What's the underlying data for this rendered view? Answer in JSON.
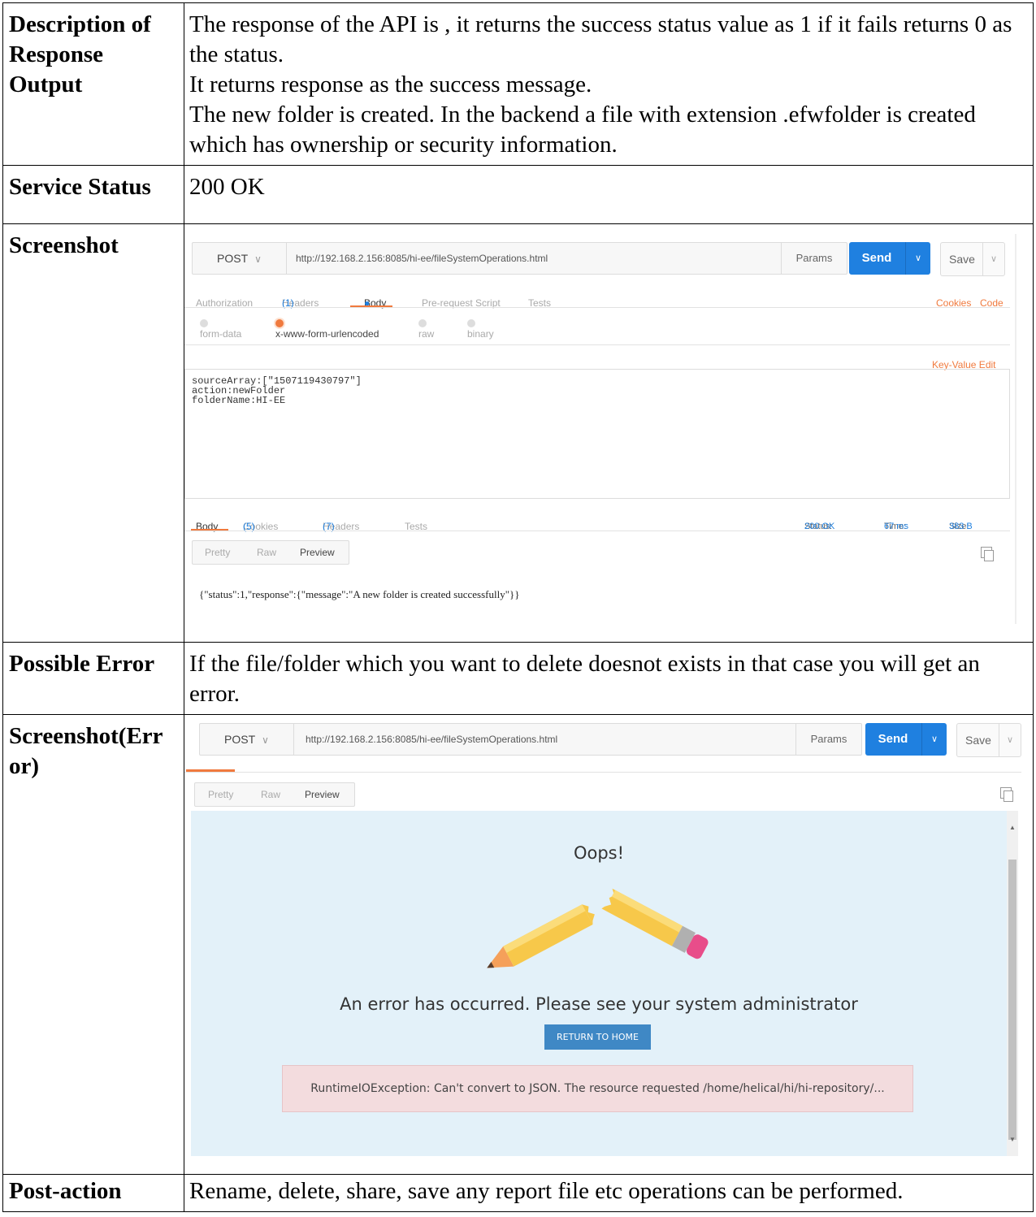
{
  "rows": {
    "description": {
      "label": "Description of Response Output",
      "lines": [
        "The response of the API is , it returns the success status value as 1 if it fails returns 0 as the status.",
        "It returns response as the success message.",
        "The new folder is created. In the backend a file with extension .efwfolder is created which has ownership or security information."
      ]
    },
    "service_status": {
      "label": "Service Status",
      "value": "200 OK"
    },
    "screenshot": {
      "label": "Screenshot"
    },
    "possible_error": {
      "label": "Possible Error",
      "value": "If the file/folder which you want to delete doesnot exists in that case you will get an error."
    },
    "screenshot_error": {
      "label": "Screenshot(Error)"
    },
    "post_action": {
      "label": "Post-action",
      "value": "Rename, delete, share, save any report file etc operations can be performed."
    }
  },
  "postman1": {
    "method": "POST",
    "url": "http://192.168.2.156:8085/hi-ee/fileSystemOperations.html",
    "params": "Params",
    "send": "Send",
    "save": "Save",
    "request_tabs": [
      {
        "label": "Authorization",
        "count": ""
      },
      {
        "label": "Headers",
        "count": "(1)"
      },
      {
        "label": "Body",
        "count": ""
      },
      {
        "label": "Pre-request Script",
        "count": ""
      },
      {
        "label": "Tests",
        "count": ""
      }
    ],
    "cookies": "Cookies",
    "code": "Code",
    "body_types": [
      "form-data",
      "x-www-form-urlencoded",
      "raw",
      "binary"
    ],
    "key_value_edit": "Key-Value Edit",
    "body_lines": [
      "sourceArray:[\"1507119430797\"]",
      "action:newFolder",
      "folderName:HI-EE"
    ],
    "response_tabs": [
      {
        "label": "Body",
        "count": ""
      },
      {
        "label": "Cookies",
        "count": "(5)"
      },
      {
        "label": "Headers",
        "count": "(7)"
      },
      {
        "label": "Tests",
        "count": ""
      }
    ],
    "status_label": "Status:",
    "status_value": "200 OK",
    "time_label": "Time:",
    "time_value": "67 ms",
    "size_label": "Size:",
    "size_value": "383 B",
    "view_modes": [
      "Pretty",
      "Raw",
      "Preview"
    ],
    "response_text": "{\"status\":1,\"response\":{\"message\":\"A new folder is created successfully\"}}"
  },
  "postman2": {
    "method": "POST",
    "url": "http://192.168.2.156:8085/hi-ee/fileSystemOperations.html",
    "params": "Params",
    "send": "Send",
    "save": "Save",
    "view_modes": [
      "Pretty",
      "Raw",
      "Preview"
    ],
    "oops": "Oops!",
    "message": "An error has occurred. Please see your system administrator",
    "return_button": "RETURN TO HOME",
    "exception": "RuntimeIOException: Can't convert to JSON. The resource requested /home/helical/hi/hi-repository/..."
  },
  "colors": {
    "accent_orange": "#f07a3e",
    "send_blue": "#1f80e0",
    "error_bg": "#e3f1f9",
    "error_box": "#f3dcde"
  }
}
